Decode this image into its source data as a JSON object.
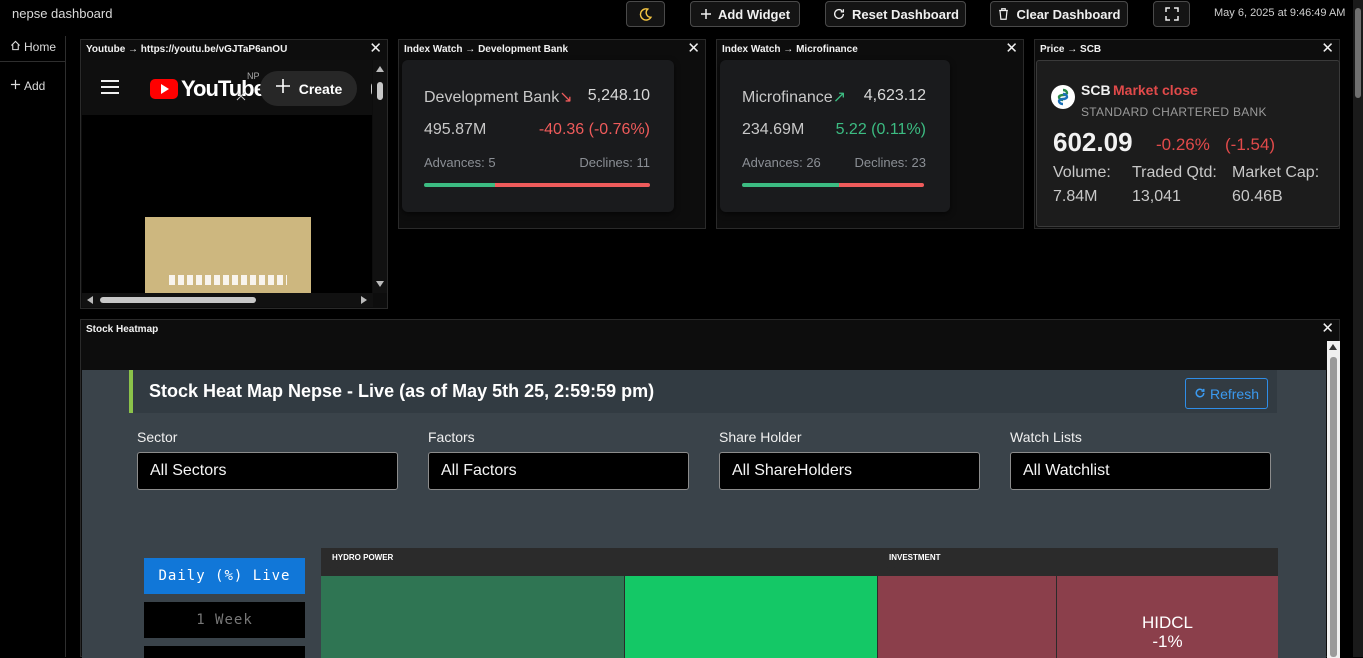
{
  "app": {
    "title": "nepse dashboard",
    "datetime": "May 6, 2025 at 9:46:49 AM"
  },
  "toolbar": {
    "theme_icon": "moon-icon",
    "add_widget": "Add Widget",
    "reset_dashboard": "Reset Dashboard",
    "clear_dashboard": "Clear Dashboard",
    "fullscreen_icon": "fullscreen-icon"
  },
  "sidebar": {
    "items": [
      {
        "label": "Home",
        "icon": "home-icon"
      },
      {
        "label": "Add",
        "icon": "plus-icon"
      }
    ]
  },
  "widgets": {
    "youtube": {
      "title": "Youtube → https://youtu.be/vGJTaP6anOU",
      "logo_text": "YouTube",
      "region": "NP",
      "create_label": "Create"
    },
    "dev_bank": {
      "title": "Index Watch → Development Bank",
      "name": "Development Bank",
      "arrow": "↘",
      "value": "5,248.10",
      "turnover": "495.87M",
      "change": "-40.36 (-0.76%)",
      "advances": "Advances: 5",
      "declines": "Declines: 11",
      "advance_fraction": 0.3125,
      "trend_color": "#ef5b5b"
    },
    "microfinance": {
      "title": "Index Watch → Microfinance",
      "name": "Microfinance",
      "arrow": "↗",
      "value": "4,623.12",
      "turnover": "234.69M",
      "change": "5.22 (0.11%)",
      "advances": "Advances: 26",
      "declines": "Declines: 23",
      "advance_fraction": 0.5306,
      "trend_color": "#3cbc82"
    },
    "price": {
      "title": "Price → SCB",
      "ticker": "SCB",
      "status": "Market close",
      "company": "STANDARD CHARTERED BANK",
      "price": "602.09",
      "change_pct": "-0.26%",
      "change_abs": "(-1.54)",
      "volume_label": "Volume:",
      "volume": "7.84M",
      "traded_label": "Traded Qtd:",
      "traded": "13,041",
      "mcap_label": "Market Cap:",
      "mcap": "60.46B"
    },
    "heatmap": {
      "title": "Stock Heatmap",
      "inner_title": "Stock Heat Map Nepse - Live (as of May 5th 25, 2:59:59 pm)",
      "refresh": "Refresh",
      "filters": [
        {
          "label": "Sector",
          "value": "All Sectors"
        },
        {
          "label": "Factors",
          "value": "All Factors"
        },
        {
          "label": "Share Holder",
          "value": "All ShareHolders"
        },
        {
          "label": "Watch Lists",
          "value": "All Watchlist"
        }
      ],
      "periods": [
        {
          "label": "Daily (%) Live",
          "active": true
        },
        {
          "label": "1 Week",
          "active": false
        }
      ],
      "sectors": [
        {
          "name": "HYDRO POWER"
        },
        {
          "name": "INVESTMENT"
        }
      ],
      "tiles": [
        {
          "label": "",
          "change": "",
          "color": "#2f7553"
        },
        {
          "label": "",
          "change": "",
          "color": "#14c866"
        },
        {
          "label": "",
          "change": "",
          "color": "#8b3f4b"
        },
        {
          "label": "HIDCL",
          "change": "-1%",
          "color": "#8b3f4b"
        }
      ]
    }
  }
}
